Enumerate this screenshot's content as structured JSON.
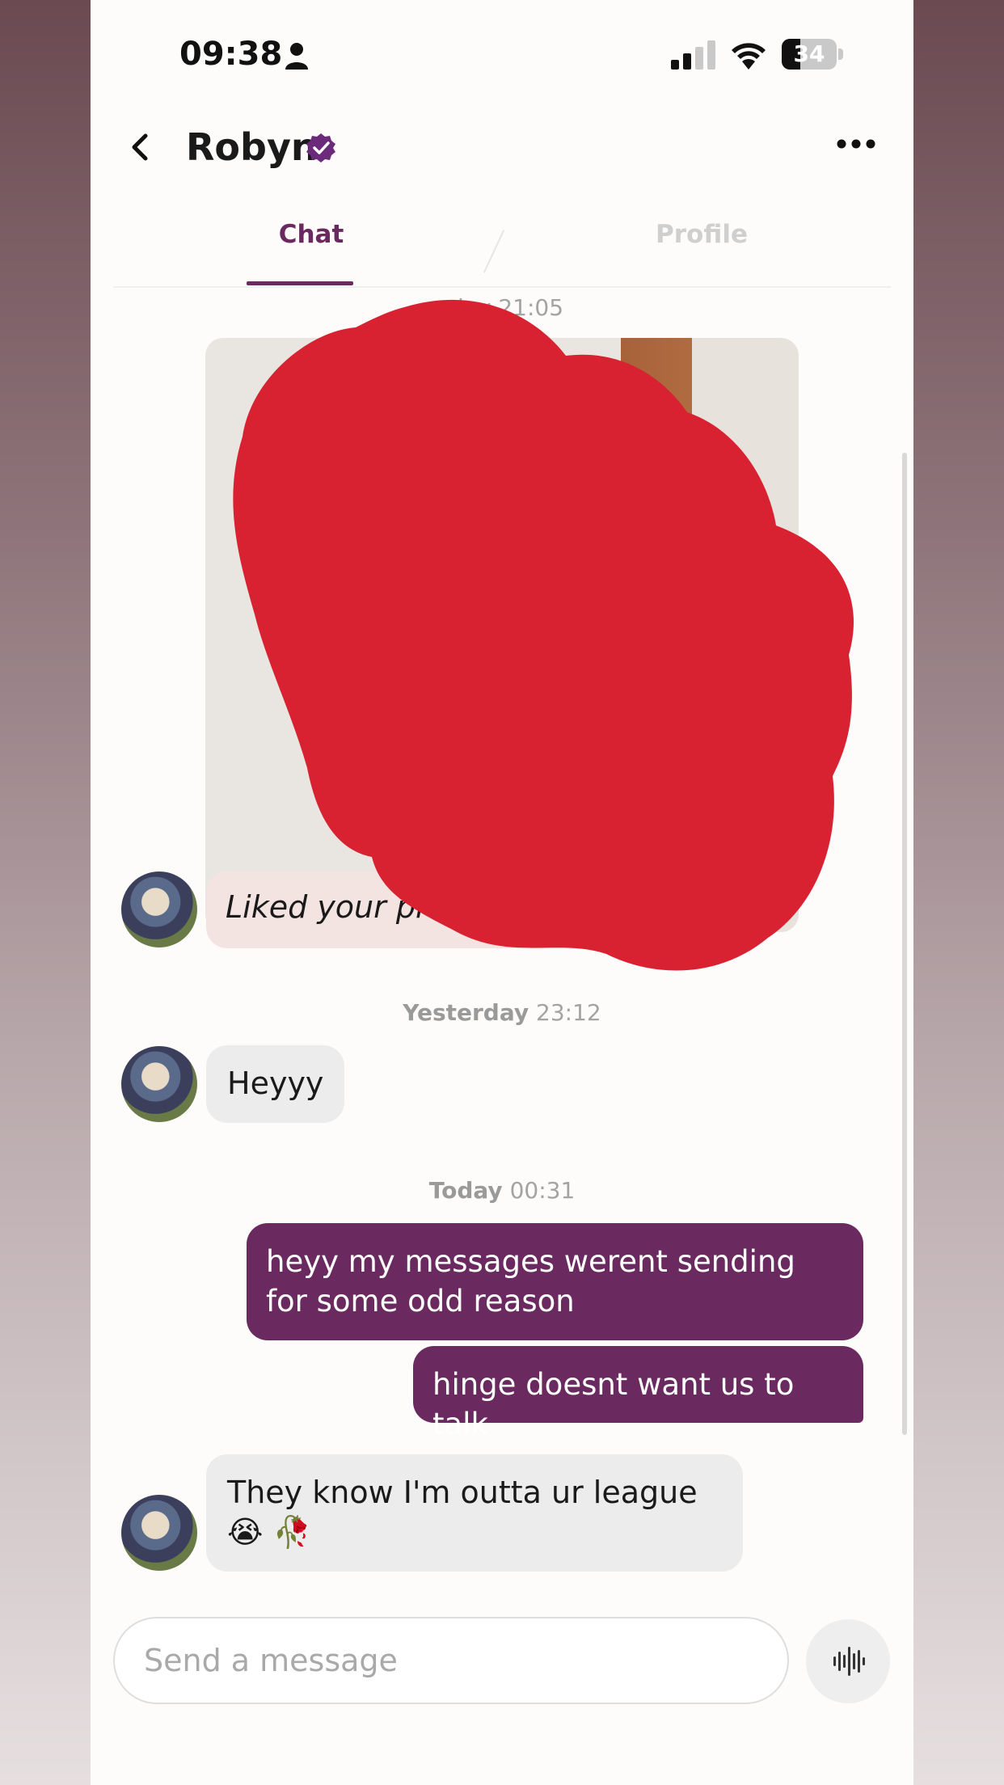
{
  "status_bar": {
    "time": "09:38",
    "battery": "34",
    "battery_level": 0.34
  },
  "header": {
    "name": "Robyn"
  },
  "tabs": [
    {
      "label": "Chat",
      "active": true
    },
    {
      "label": "Profile",
      "active": false
    }
  ],
  "timestamps": [
    {
      "day": "",
      "time": "rday 21:05"
    },
    {
      "day": "Yesterday",
      "time": "23:12"
    },
    {
      "day": "Today",
      "time": "00:31"
    }
  ],
  "messages": {
    "liked": "Liked your pl",
    "heyyy": "Heyyy",
    "out_1": "heyy my messages werent sending for some odd reason",
    "out_2": "hinge doesnt want us to talk",
    "reply": "They know I'm outta ur league 😭 🥀"
  },
  "composer": {
    "placeholder": "Send a message"
  },
  "colors": {
    "accent": "#6b2a5f",
    "redaction": "#d92231",
    "incoming_bubble": "#ececec",
    "liked_bubble": "#f3e4e1"
  }
}
